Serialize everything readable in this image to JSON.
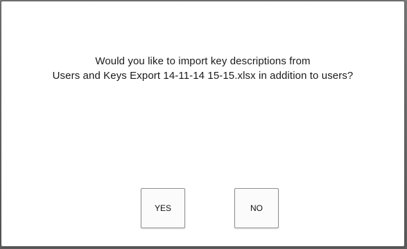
{
  "dialog": {
    "message_line1": "Would you like to import key descriptions from",
    "message_line2": "Users and Keys Export 14-11-14 15-15.xlsx in addition to users?",
    "yes_label": "YES",
    "no_label": "NO"
  }
}
